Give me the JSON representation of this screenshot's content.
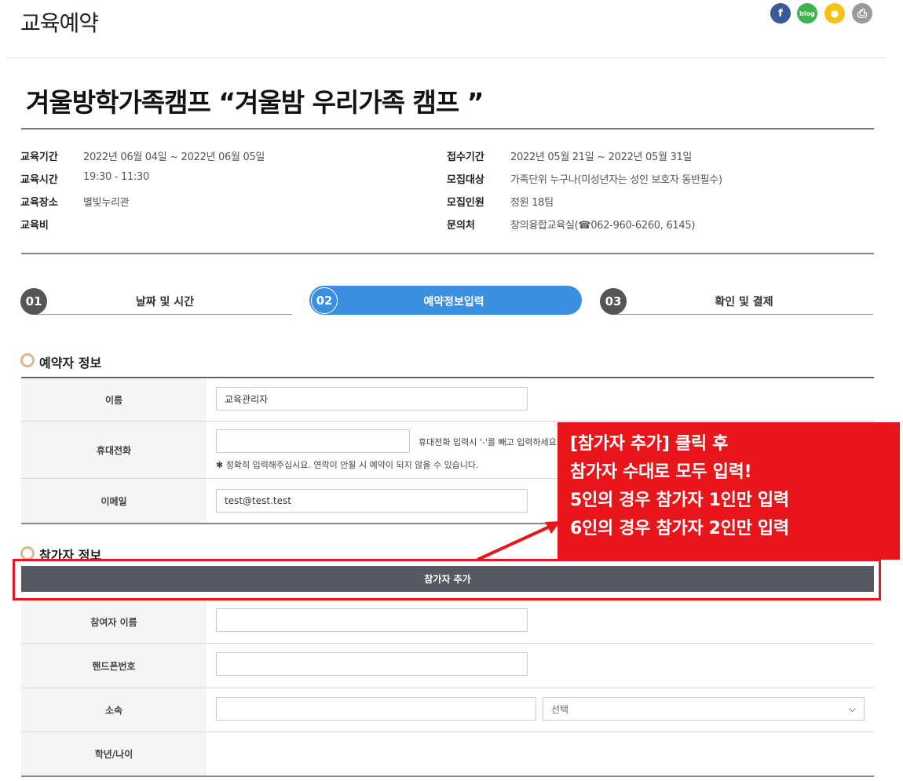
{
  "header": {
    "page_title": "교육예약",
    "share_icons": [
      {
        "name": "facebook-icon",
        "glyph": "f",
        "color": "#3b5998"
      },
      {
        "name": "blog-icon",
        "glyph": "blog",
        "color": "#3fb34f"
      },
      {
        "name": "kakaostory-icon",
        "glyph": "●",
        "color": "#f4c316"
      },
      {
        "name": "print-icon",
        "glyph": "⎙",
        "color": "#9a9a9a"
      }
    ]
  },
  "course": {
    "title": "겨울방학가족캠프 “겨울밤 우리가족 캠프 ”",
    "info_left": [
      {
        "label": "교육기간",
        "value": "2022년 06월 04일 ~ 2022년 06월 05일"
      },
      {
        "label": "교육시간",
        "value": "19:30 - 11:30"
      },
      {
        "label": "교육장소",
        "value": "별빛누리관"
      },
      {
        "label": "교육비",
        "value": ""
      }
    ],
    "info_right": [
      {
        "label": "접수기간",
        "value": "2022년 05월 21일 ~ 2022년 05월 31일"
      },
      {
        "label": "모집대상",
        "value": "가족단위 누구나(미성년자는 성인 보호자 동반필수)"
      },
      {
        "label": "모집인원",
        "value": "정원 18팀"
      },
      {
        "label": "문의처",
        "value": "창의융합교육실(☎062-960-6260, 6145)"
      }
    ]
  },
  "steps": [
    {
      "num": "01",
      "label": "날짜 및 시간",
      "active": false
    },
    {
      "num": "02",
      "label": "예약정보입력",
      "active": true
    },
    {
      "num": "03",
      "label": "확인 및 결제",
      "active": false
    }
  ],
  "reserver": {
    "section_title": "예약자 정보",
    "name_label": "이름",
    "name_value": "교육관리자",
    "phone_label": "휴대전화",
    "phone_value": "",
    "phone_hint": "휴대전화 입력시 '-'를 빼고 입력하세요",
    "phone_notice": "✱ 정확히 입력해주십시요. 연락이 안될 시 예약이 되지 않을 수 있습니다.",
    "email_label": "이메일",
    "email_value": "test@test.test"
  },
  "participant": {
    "section_title": "참가자 정보",
    "add_button": "참가자 추가",
    "name_label": "참여자 이름",
    "phone_label": "핸드폰번호",
    "affil_label": "소속",
    "affil_select": "선택",
    "grade_label": "학년/나이"
  },
  "callout": {
    "lines": [
      "[참가자 추가] 클릭 후",
      "참가자 수대로 모두 입력!",
      "5인의 경우 참가자 1인만 입력",
      "6인의 경우 참가자 2인만 입력"
    ],
    "color": "#e8151b"
  },
  "accent_color": "#3a8fe0"
}
